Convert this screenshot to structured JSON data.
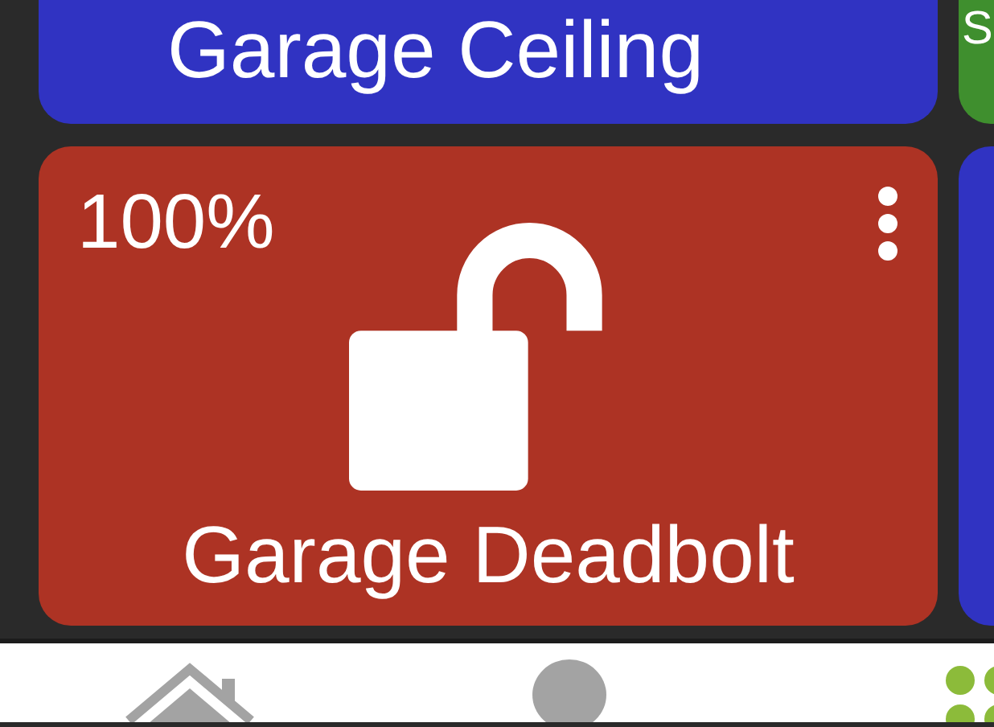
{
  "tiles": [
    {
      "kind": "switch",
      "name": "Garage Ceiling",
      "color": "#3033c2"
    },
    {
      "kind": "switch",
      "name": "S",
      "color": "#3f8f2e"
    },
    {
      "kind": "lock",
      "name": "Garage Deadbolt",
      "reading": "100%",
      "locked": false,
      "color": "#ad3324"
    },
    {
      "kind": "switch",
      "color": "#3033c2"
    }
  ],
  "bottom_nav": [
    {
      "kind": "home",
      "selected": false
    },
    {
      "kind": "person",
      "selected": false
    },
    {
      "kind": "grid",
      "selected": true
    }
  ]
}
